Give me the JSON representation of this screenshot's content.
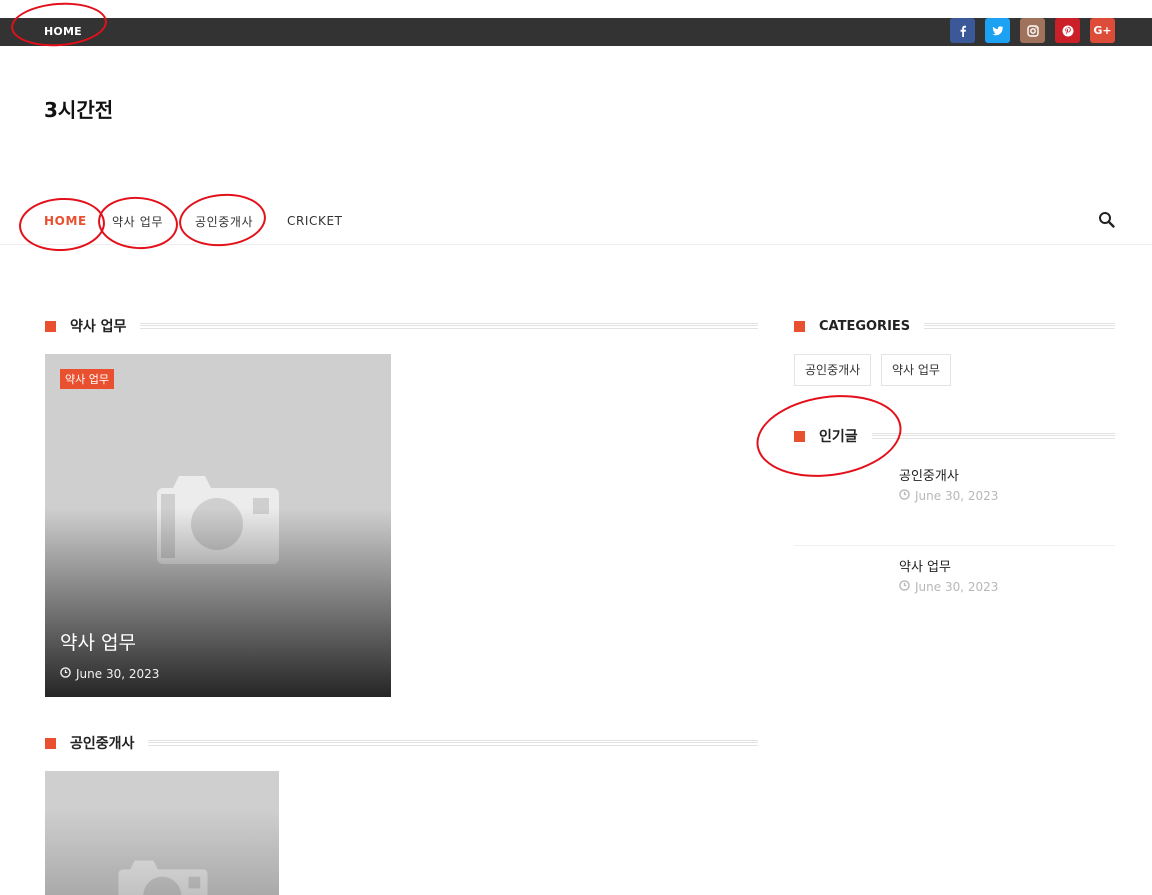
{
  "topbar": {
    "home_label": "HOME",
    "social": [
      {
        "name": "facebook",
        "glyph": "f",
        "color": "#3b5998"
      },
      {
        "name": "twitter",
        "glyph": "t",
        "color": "#1da1f2"
      },
      {
        "name": "instagram",
        "glyph": "i",
        "color": "#a0725b"
      },
      {
        "name": "pinterest",
        "glyph": "p",
        "color": "#cb2027"
      },
      {
        "name": "google-plus",
        "glyph": "G+",
        "color": "#dd4b39"
      }
    ]
  },
  "site": {
    "title": "3시간전"
  },
  "nav": {
    "items": [
      {
        "label": "HOME",
        "active": true
      },
      {
        "label": "약사 업무",
        "active": false
      },
      {
        "label": "공인중개사",
        "active": false
      },
      {
        "label": "CRICKET",
        "active": false
      }
    ]
  },
  "main": {
    "section1": {
      "heading": "약사 업무",
      "card": {
        "tag": "약사 업무",
        "title": "약사 업무",
        "date": "June 30, 2023"
      }
    },
    "section2": {
      "heading": "공인중개사"
    }
  },
  "sidebar": {
    "categories": {
      "heading": "CATEGORIES",
      "items": [
        "공인중개사",
        "약사 업무"
      ]
    },
    "popular": {
      "heading": "인기글",
      "posts": [
        {
          "title": "공인중개사",
          "date": "June 30, 2023"
        },
        {
          "title": "약사 업무",
          "date": "June 30, 2023"
        }
      ]
    }
  },
  "colors": {
    "accent": "#e8502f",
    "topbar": "#333333",
    "annotation": "#e3101a"
  }
}
